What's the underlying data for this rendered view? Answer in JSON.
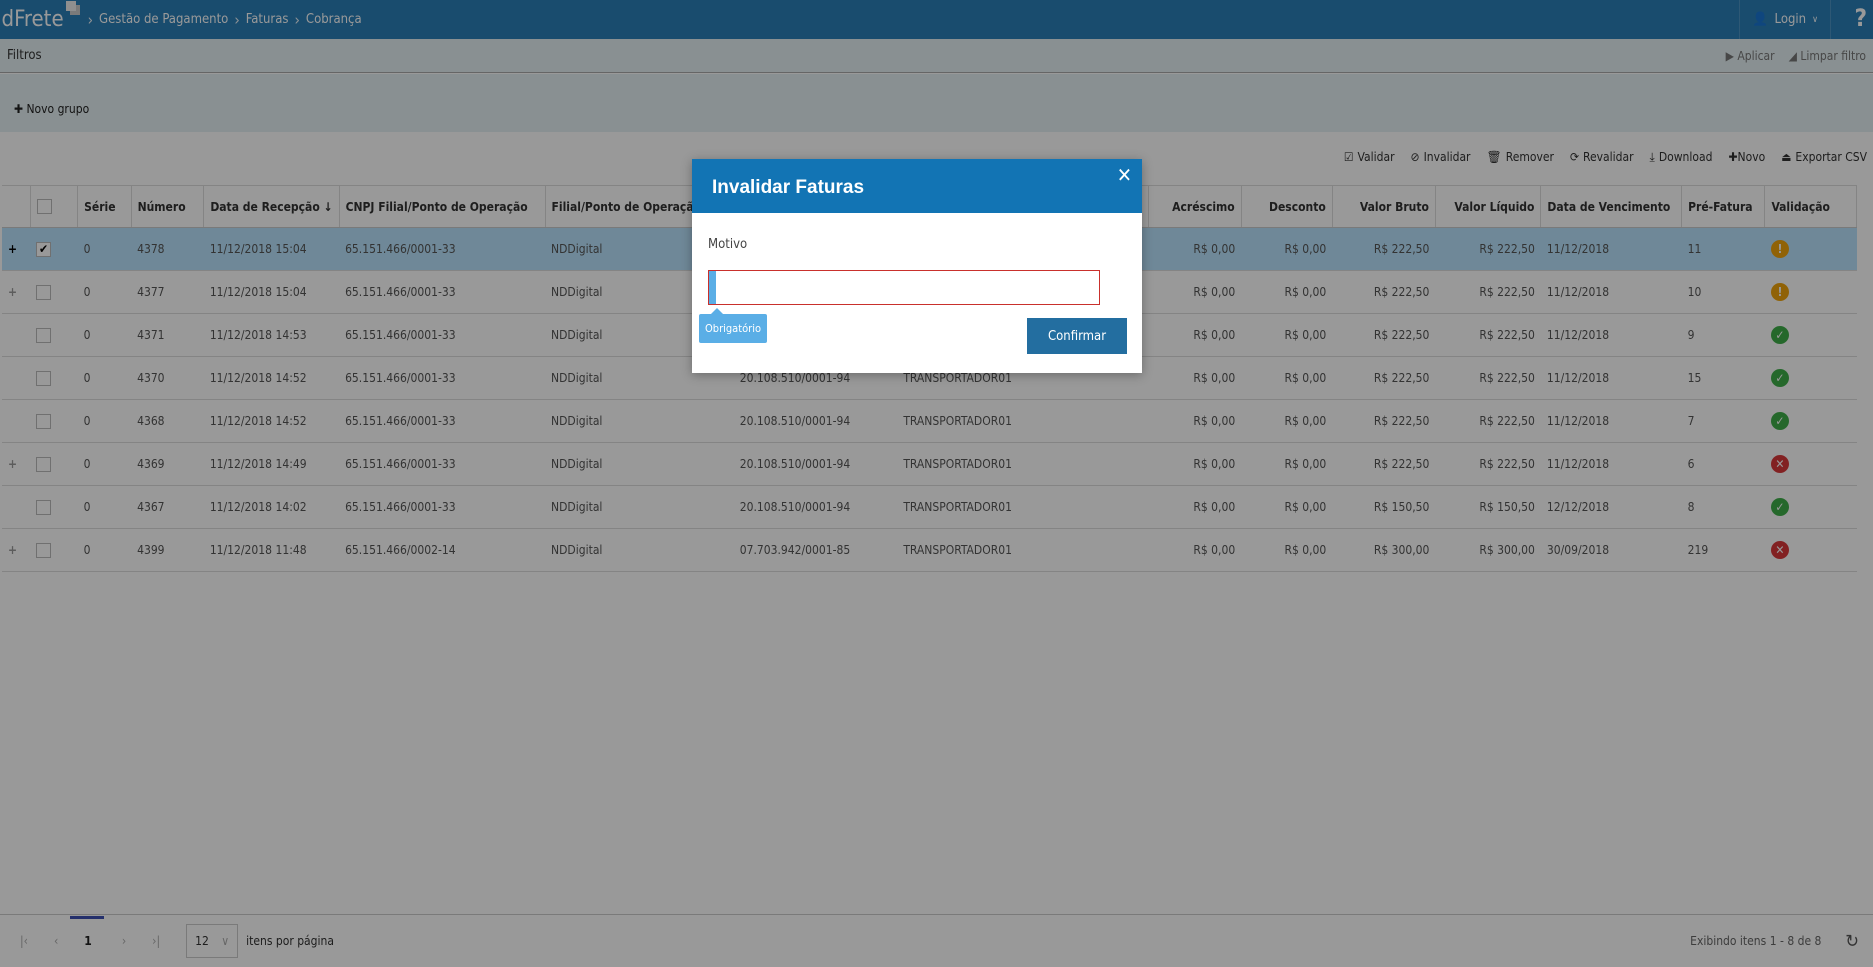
{
  "header": {
    "logo": "ldFrete",
    "breadcrumb": [
      "Gestão de Pagamento",
      "Faturas",
      "Cobrança"
    ],
    "login": "Login",
    "help": "?"
  },
  "filters": {
    "title": "Filtros",
    "apply": "Aplicar",
    "clear": "Limpar filtro",
    "new_group": "Novo grupo"
  },
  "toolbar": [
    "Validar",
    "Invalidar",
    "Remover",
    "Revalidar",
    "Download",
    "Novo",
    "Exportar CSV"
  ],
  "columns": [
    "",
    "",
    "Série",
    "Número",
    "Data de Recepção ↓",
    "CNPJ Filial/Ponto de Operação",
    "Filial/Ponto de Operação",
    "",
    "",
    "Acréscimo",
    "Desconto",
    "Valor Bruto",
    "Valor Líquido",
    "Data de Vencimento",
    "Pré-Fatura",
    "Validação"
  ],
  "rows": [
    {
      "expand": "+",
      "checked": true,
      "serie": "0",
      "numero": "4378",
      "data": "11/12/2018 15:04",
      "cnpj": "65.151.466/0001-33",
      "filial": "NDDigital",
      "cnpj_t": "",
      "transp": "",
      "acresc": "R$ 0,00",
      "desc": "R$ 0,00",
      "bruto": "R$ 222,50",
      "liquido": "R$ 222,50",
      "venc": "11/12/2018",
      "pre": "11",
      "status": "warning"
    },
    {
      "expand": "+",
      "checked": false,
      "serie": "0",
      "numero": "4377",
      "data": "11/12/2018 15:04",
      "cnpj": "65.151.466/0001-33",
      "filial": "NDDigital",
      "cnpj_t": "",
      "transp": "",
      "acresc": "R$ 0,00",
      "desc": "R$ 0,00",
      "bruto": "R$ 222,50",
      "liquido": "R$ 222,50",
      "venc": "11/12/2018",
      "pre": "10",
      "status": "warning"
    },
    {
      "expand": "",
      "checked": false,
      "serie": "0",
      "numero": "4371",
      "data": "11/12/2018 14:53",
      "cnpj": "65.151.466/0001-33",
      "filial": "NDDigital",
      "cnpj_t": "",
      "transp": "",
      "acresc": "R$ 0,00",
      "desc": "R$ 0,00",
      "bruto": "R$ 222,50",
      "liquido": "R$ 222,50",
      "venc": "11/12/2018",
      "pre": "9",
      "status": "valid"
    },
    {
      "expand": "",
      "checked": false,
      "serie": "0",
      "numero": "4370",
      "data": "11/12/2018 14:52",
      "cnpj": "65.151.466/0001-33",
      "filial": "NDDigital",
      "cnpj_t": "20.108.510/0001-94",
      "transp": "TRANSPORTADOR01",
      "acresc": "R$ 0,00",
      "desc": "R$ 0,00",
      "bruto": "R$ 222,50",
      "liquido": "R$ 222,50",
      "venc": "11/12/2018",
      "pre": "15",
      "status": "valid"
    },
    {
      "expand": "",
      "checked": false,
      "serie": "0",
      "numero": "4368",
      "data": "11/12/2018 14:52",
      "cnpj": "65.151.466/0001-33",
      "filial": "NDDigital",
      "cnpj_t": "20.108.510/0001-94",
      "transp": "TRANSPORTADOR01",
      "acresc": "R$ 0,00",
      "desc": "R$ 0,00",
      "bruto": "R$ 222,50",
      "liquido": "R$ 222,50",
      "venc": "11/12/2018",
      "pre": "7",
      "status": "valid"
    },
    {
      "expand": "+",
      "checked": false,
      "serie": "0",
      "numero": "4369",
      "data": "11/12/2018 14:49",
      "cnpj": "65.151.466/0001-33",
      "filial": "NDDigital",
      "cnpj_t": "20.108.510/0001-94",
      "transp": "TRANSPORTADOR01",
      "acresc": "R$ 0,00",
      "desc": "R$ 0,00",
      "bruto": "R$ 222,50",
      "liquido": "R$ 222,50",
      "venc": "11/12/2018",
      "pre": "6",
      "status": "invalid"
    },
    {
      "expand": "",
      "checked": false,
      "serie": "0",
      "numero": "4367",
      "data": "11/12/2018 14:02",
      "cnpj": "65.151.466/0001-33",
      "filial": "NDDigital",
      "cnpj_t": "20.108.510/0001-94",
      "transp": "TRANSPORTADOR01",
      "acresc": "R$ 0,00",
      "desc": "R$ 0,00",
      "bruto": "R$ 150,50",
      "liquido": "R$ 150,50",
      "venc": "12/12/2018",
      "pre": "8",
      "status": "valid"
    },
    {
      "expand": "+",
      "checked": false,
      "serie": "0",
      "numero": "4399",
      "data": "11/12/2018 11:48",
      "cnpj": "65.151.466/0002-14",
      "filial": "NDDigital",
      "cnpj_t": "07.703.942/0001-85",
      "transp": "TRANSPORTADOR01",
      "acresc": "R$ 0,00",
      "desc": "R$ 0,00",
      "bruto": "R$ 300,00",
      "liquido": "R$ 300,00",
      "venc": "30/09/2018",
      "pre": "219",
      "status": "invalid"
    }
  ],
  "status_colors": {
    "warning": "#f0a30a",
    "valid": "#3fae49",
    "invalid": "#d9383a"
  },
  "pagination": {
    "page": "1",
    "page_size": "12",
    "per_page_label": "itens por página",
    "info": "Exibindo itens 1 - 8 de 8"
  },
  "modal": {
    "title": "Invalidar Faturas",
    "field_label": "Motivo",
    "field_value": "",
    "tooltip": "Obrigatório",
    "confirm": "Confirmar",
    "close": "✕"
  }
}
